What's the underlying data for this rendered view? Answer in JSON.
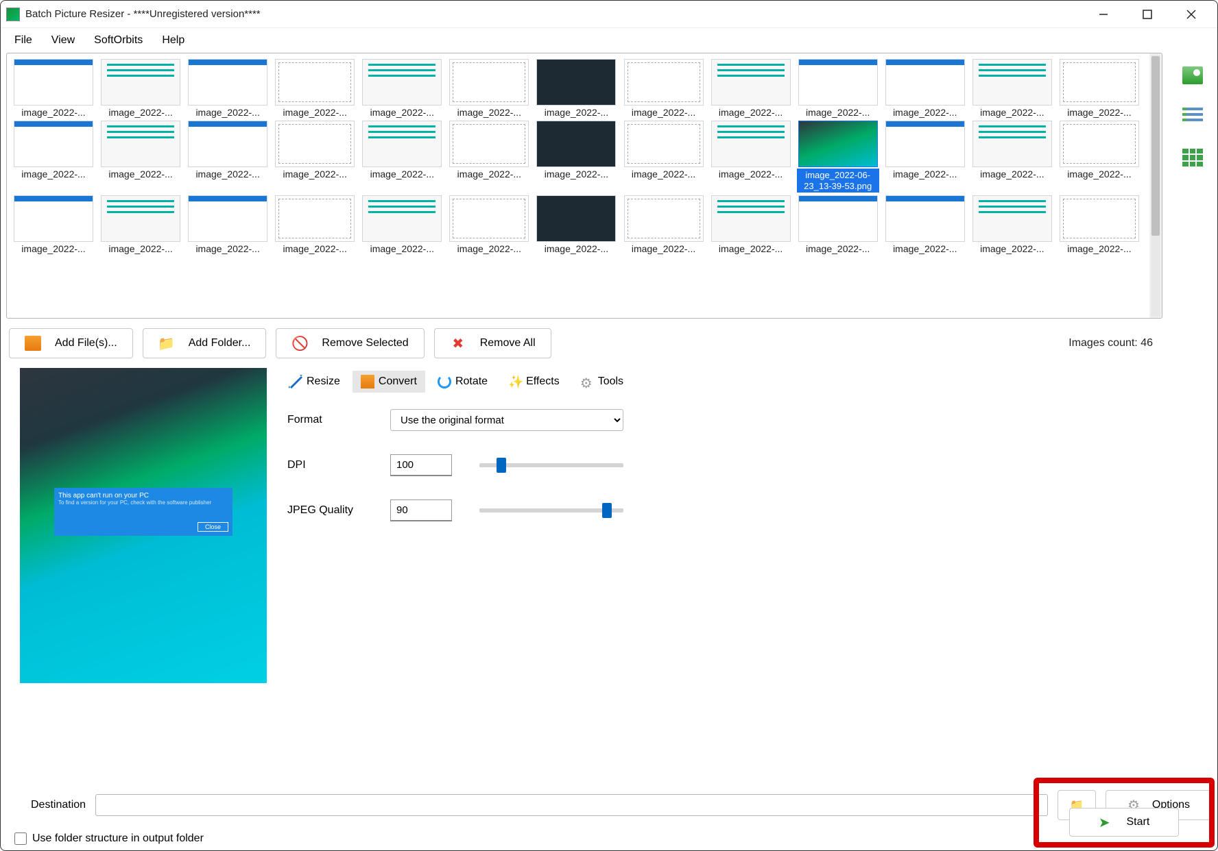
{
  "window": {
    "title": "Batch Picture Resizer - ****Unregistered version****"
  },
  "menu": [
    "File",
    "View",
    "SoftOrbits",
    "Help"
  ],
  "thumbnails": {
    "generic_label": "image_2022-...",
    "selected_label": "image_2022-06-23_13-39-53.png",
    "selected_index": 22,
    "total_shown": 39
  },
  "actions": {
    "add_file": "Add File(s)...",
    "add_folder": "Add Folder...",
    "remove_selected": "Remove Selected",
    "remove_all": "Remove All",
    "count": "Images count: 46"
  },
  "tabs": {
    "resize": "Resize",
    "convert": "Convert",
    "rotate": "Rotate",
    "effects": "Effects",
    "tools": "Tools",
    "active": "convert"
  },
  "form": {
    "format_label": "Format",
    "format_value": "Use the original format",
    "dpi_label": "DPI",
    "dpi_value": "100",
    "jpeg_label": "JPEG Quality",
    "jpeg_value": "90"
  },
  "bottom": {
    "destination_label": "Destination",
    "destination_value": "",
    "options": "Options",
    "folder_structure": "Use folder structure in output folder",
    "start": "Start"
  },
  "preview_dialog": {
    "title": "This app can't run on your PC",
    "sub": "To find a version for your PC, check with the software publisher",
    "btn": "Close"
  }
}
